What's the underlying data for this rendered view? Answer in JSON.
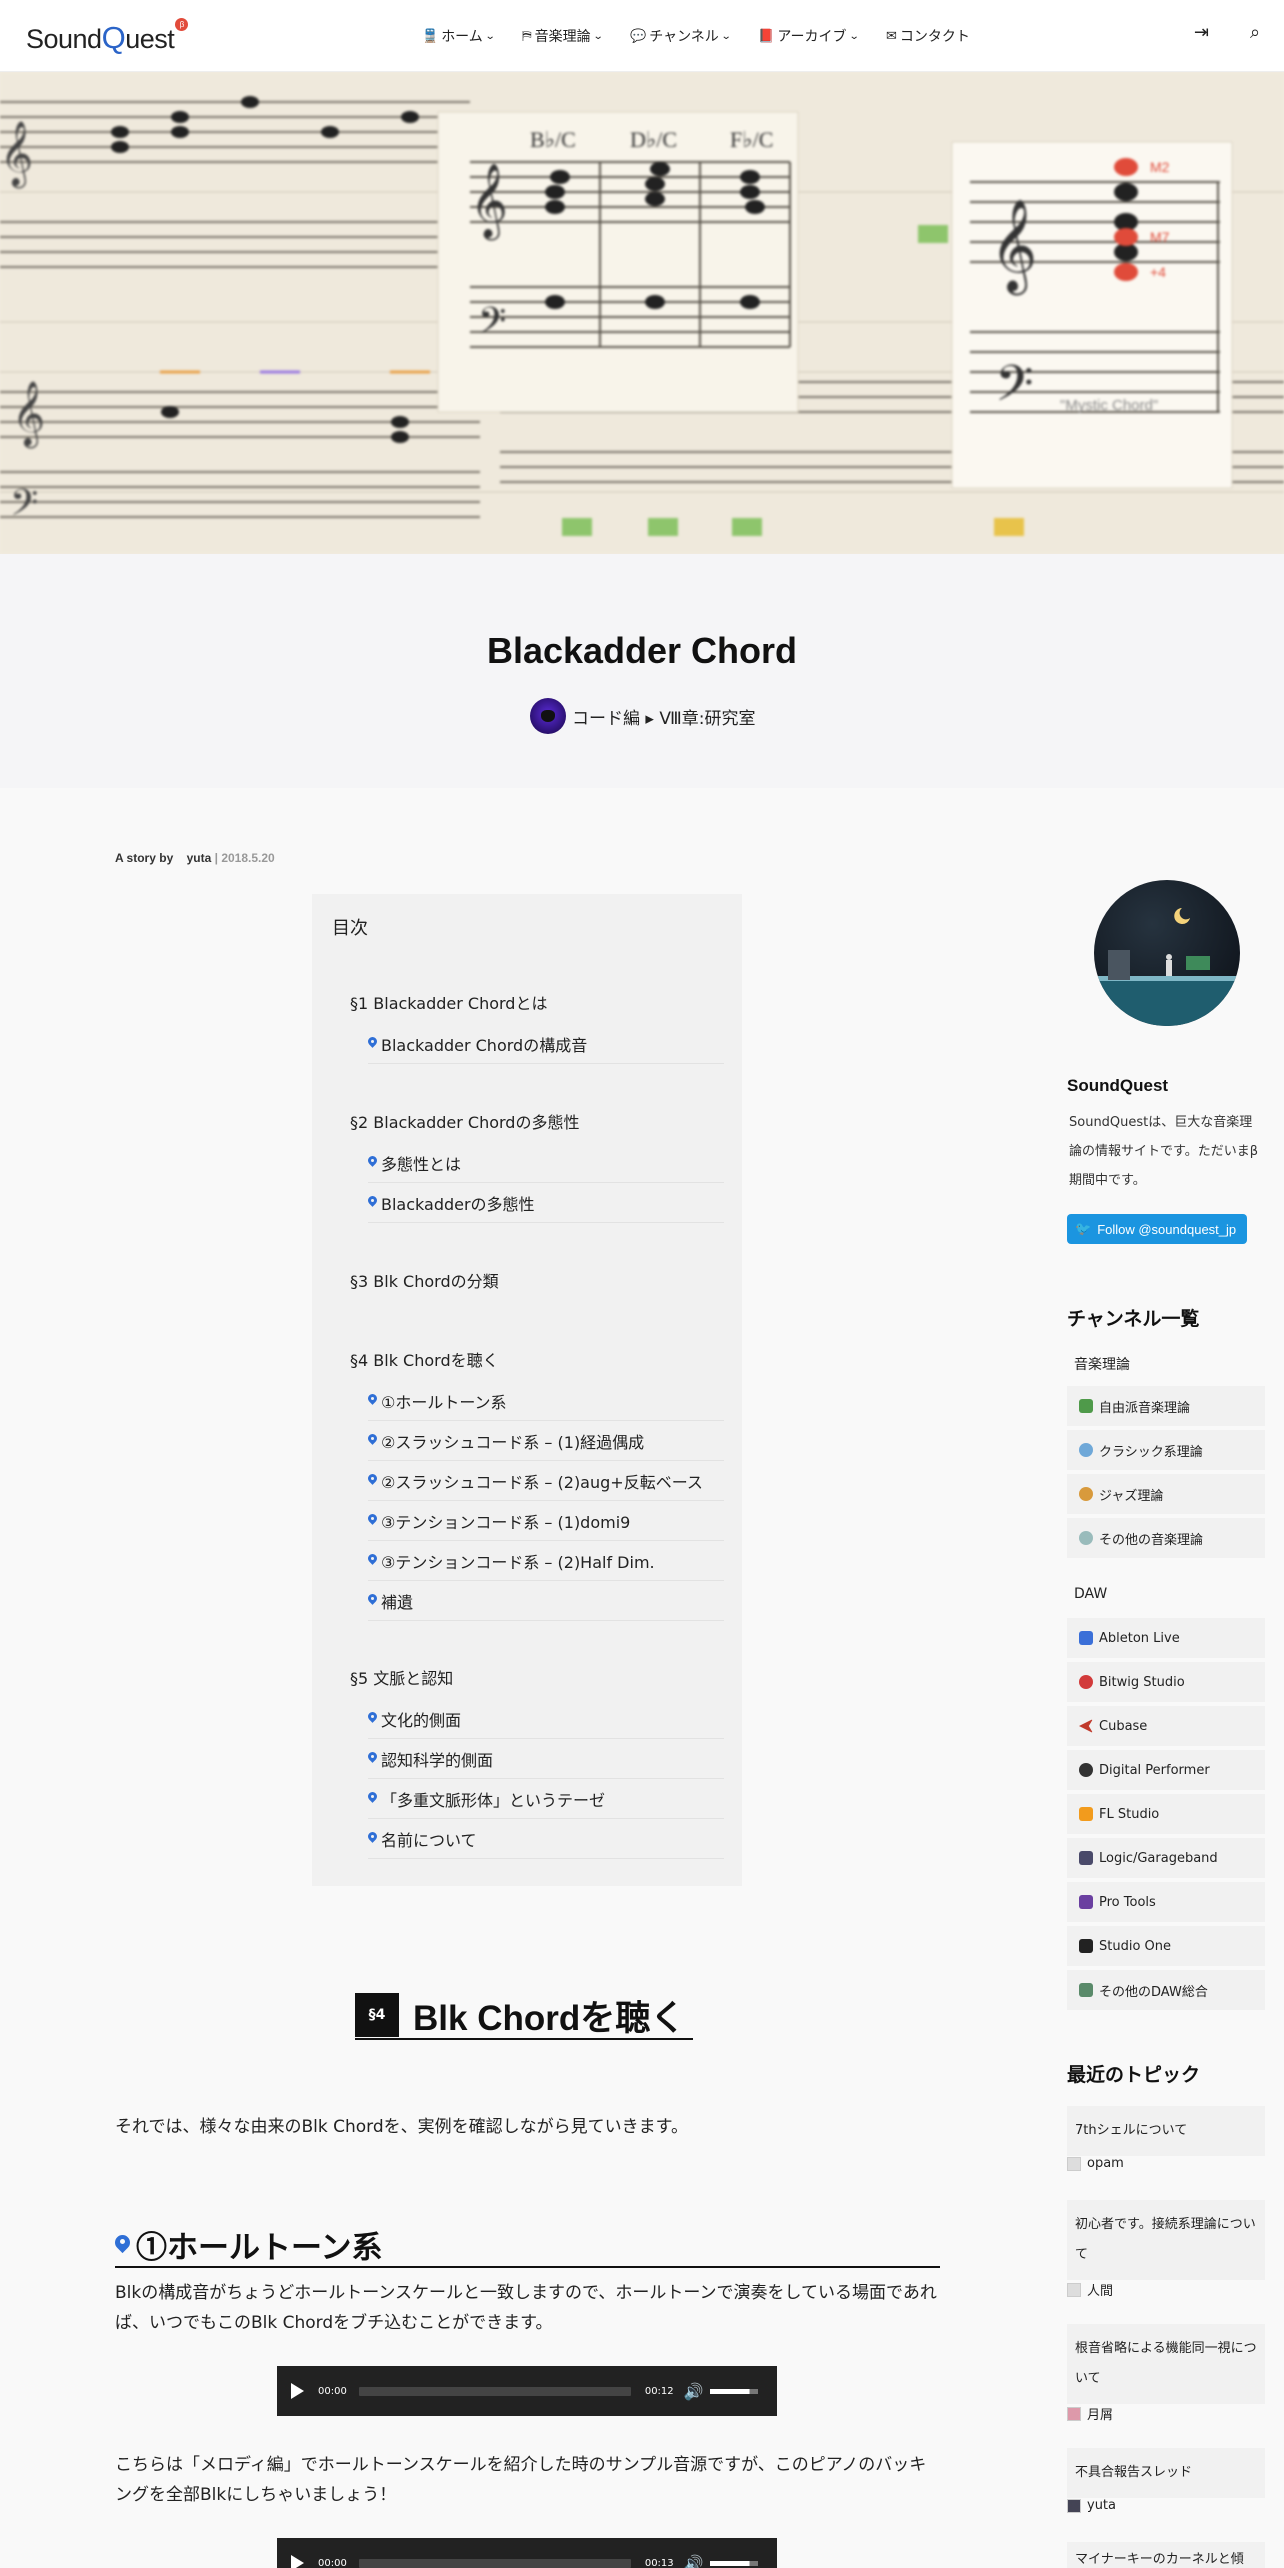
{
  "header": {
    "logo_text": "Sound",
    "logo_q": "Q",
    "logo_rest": "uest",
    "logo_badge": "β",
    "nav": [
      {
        "icon": "train-icon",
        "label": "ホーム"
      },
      {
        "icon": "signpost-icon",
        "label": "音楽理論"
      },
      {
        "icon": "chat-icon",
        "label": "チャンネル"
      },
      {
        "icon": "book-icon",
        "label": "アーカイブ"
      },
      {
        "icon": "mail-icon",
        "label": "コンタクト"
      }
    ]
  },
  "hero": {
    "chord_labels": [
      "B♭/C",
      "D♭/C",
      "F♭/C"
    ],
    "tension_labels": [
      "M2",
      "M7",
      "+4"
    ],
    "caption": "\"Mystic Chord\""
  },
  "post": {
    "title": "Blackadder Chord",
    "category": "コード編 ▸ Ⅷ章:研究室",
    "meta_by": "A story by",
    "meta_author": "yuta",
    "meta_date": "| 2018.5.20"
  },
  "toc": {
    "title": "目次",
    "sections": [
      {
        "label": "§1 Blackadder Chordとは",
        "items": [
          "Blackadder Chordの構成音"
        ]
      },
      {
        "label": "§2 Blackadder Chordの多態性",
        "items": [
          "多態性とは",
          "Blackadderの多態性"
        ]
      },
      {
        "label": "§3 Blk Chordの分類",
        "items": []
      },
      {
        "label": "§4 Blk Chordを聴く",
        "items": [
          "①ホールトーン系",
          "②スラッシュコード系 – (1)経過偶成",
          "②スラッシュコード系 – (2)aug+反転ベース",
          "③テンションコード系 – (1)domi9",
          "③テンションコード系 – (2)Half Dim.",
          "補遺"
        ]
      },
      {
        "label": "§5 文脈と認知",
        "items": [
          "文化的側面",
          "認知科学的側面",
          "「多重文脈形体」というテーゼ",
          "名前について"
        ]
      }
    ]
  },
  "article": {
    "section_badge": "§4",
    "section_title": "Blk Chordを聴く",
    "intro": "それでは、様々な由来のBlk Chordを、実例を確認しながら見ていきます。",
    "sub_title": "①ホールトーン系",
    "body1": "Blkの構成音がちょうどホールトーンスケールと一致しますので、ホールトーンで演奏をしている場面であれば、いつでもこのBlk Chordをブチ込むことができます。",
    "body2": "こちらは「メロディ編」でホールトーンスケールを紹介した時のサンプル音源ですが、このピアノのバッキングを全部Blkにしちゃいましょう！",
    "player1": {
      "current": "00:00",
      "duration": "00:12"
    },
    "player2": {
      "current": "00:00",
      "duration": "00:13"
    }
  },
  "sidebar": {
    "name": "SoundQuest",
    "desc": "SoundQuestは、巨大な音楽理論の情報サイトです。ただいまβ期間中です。",
    "follow": "Follow @soundquest_jp",
    "channels_title": "チャンネル一覧",
    "group1": "音楽理論",
    "theory": [
      "自由派音楽理論",
      "クラシック系理論",
      "ジャズ理論",
      "その他の音楽理論"
    ],
    "group2": "DAW",
    "daw": [
      "Ableton Live",
      "Bitwig Studio",
      "Cubase",
      "Digital Performer",
      "FL Studio",
      "Logic/Garageband",
      "Pro Tools",
      "Studio One",
      "その他のDAW総合"
    ],
    "topics_title": "最近のトピック",
    "topics": [
      {
        "title": "7thシェルについて",
        "user": "opam"
      },
      {
        "title": "初心者です。接続系理論について",
        "user": "人間"
      },
      {
        "title": "根音省略による機能同一視について",
        "user": "月屑"
      },
      {
        "title": "不具合報告スレッド",
        "user": "yuta"
      },
      {
        "title": "マイナーキーのカーネルと傾",
        "user": ""
      }
    ]
  }
}
